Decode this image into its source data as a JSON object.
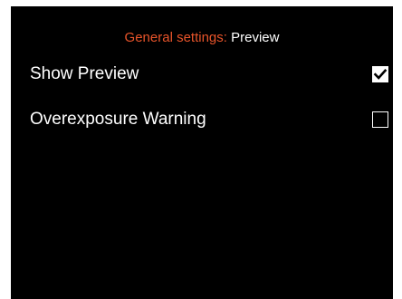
{
  "header": {
    "section": "General settings:",
    "page": "Preview"
  },
  "settings": [
    {
      "label": "Show Preview",
      "checked": true
    },
    {
      "label": "Overexposure Warning",
      "checked": false
    }
  ],
  "colors": {
    "background": "#000000",
    "accent": "#e8542a",
    "text": "#ffffff"
  },
  "icons": {
    "checked": "checkmark-icon"
  }
}
